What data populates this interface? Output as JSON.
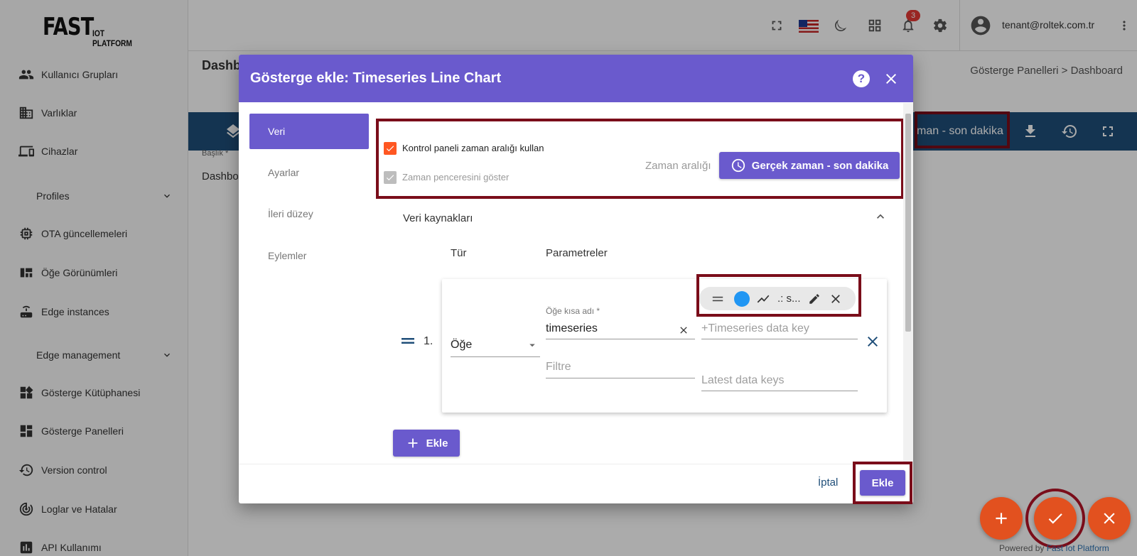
{
  "sidebar": {
    "logo_big": "FAST",
    "logo_small": "IOT PLATFORM",
    "items": [
      {
        "label": "Kullanıcı Grupları",
        "icon": "users-icon"
      },
      {
        "label": "Varlıklar",
        "icon": "building-icon"
      },
      {
        "label": "Cihazlar",
        "icon": "devices-icon"
      },
      {
        "label": "Profiles",
        "group": true
      },
      {
        "label": "OTA güncellemeleri",
        "icon": "chip-icon"
      },
      {
        "label": "Öğe Görünümleri",
        "icon": "view-quilt-icon"
      },
      {
        "label": "Edge instances",
        "icon": "router-icon"
      },
      {
        "label": "Edge management",
        "group": true
      },
      {
        "label": "Gösterge Kütüphanesi",
        "icon": "widgets-icon"
      },
      {
        "label": "Gösterge Panelleri",
        "icon": "dashboard-icon"
      },
      {
        "label": "Version control",
        "icon": "history-icon"
      },
      {
        "label": "Loglar ve Hatalar",
        "icon": "track-changes-icon"
      },
      {
        "label": "API Kullanımı",
        "icon": "bar-chart-icon"
      }
    ]
  },
  "topbar": {
    "notification_count": "3",
    "user_email": "tenant@roltek.com.tr"
  },
  "page": {
    "title": "Dashb",
    "breadcrumb": "Gösterge Panelleri  >  Dashboard",
    "toolbar_text": "man - son dakika",
    "bg_label": "Başlık *",
    "bg_value": "Dashbo"
  },
  "dialog": {
    "title": "Gösterge ekle: Timeseries Line Chart",
    "help": "?",
    "nav": [
      "Veri",
      "Ayarlar",
      "İleri düzey",
      "Eylemler"
    ],
    "use_dashboard_timewindow": "Kontrol paneli zaman aralığı kullan",
    "show_timewindow": "Zaman penceresini göster",
    "timewindow_label": "Zaman aralığı",
    "timewindow_button": "Gerçek zaman - son dakika",
    "datasources_title": "Veri kaynakları",
    "col_type": "Tür",
    "col_params": "Parametreler",
    "row_index": "1.",
    "type_value": "Öğe",
    "alias_label": "Öğe kısa adı *",
    "alias_value": "timeseries",
    "filter_placeholder": "Filtre",
    "timeseries_key_placeholder": "+Timeseries data key",
    "latest_keys_placeholder": "Latest data keys",
    "chip_label": ".: s...",
    "chip_color": "#2196f3",
    "add_datasource": "Ekle",
    "cancel": "İptal",
    "submit": "Ekle"
  },
  "footer": {
    "powered_prefix": "Powered by ",
    "powered_brand": "Fast Iot Platform"
  },
  "colors": {
    "primary": "#6a5acd",
    "toolbar": "#1f4e79",
    "fab": "#e2511f",
    "highlight_box": "#7a0d1a",
    "checkbox_checked": "#ff5722"
  }
}
